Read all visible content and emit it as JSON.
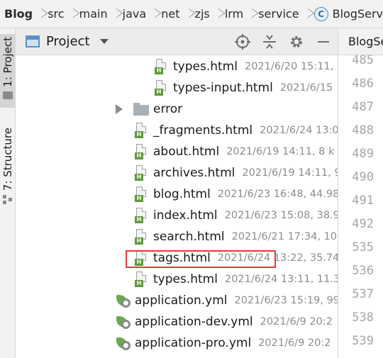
{
  "breadcrumb": {
    "items": [
      "Blog",
      "src",
      "main",
      "java",
      "net",
      "zjs",
      "lrm",
      "service"
    ],
    "current": "BlogServ",
    "class_icon_letter": "C"
  },
  "tool_strip": {
    "project_label": "1: Project",
    "structure_label": "7: Structure"
  },
  "panel": {
    "title": "Project",
    "icons": [
      "locate-icon",
      "collapse-icon",
      "gear-icon",
      "minimize-icon"
    ]
  },
  "tree": [
    {
      "type": "html",
      "name": "types.html",
      "meta": "2021/6/20 15:11,"
    },
    {
      "type": "html",
      "name": "types-input.html",
      "meta": "2021/6/15"
    },
    {
      "type": "folder",
      "name": "error",
      "meta": ""
    },
    {
      "type": "html",
      "name": "_fragments.html",
      "meta": "2021/6/24 13:0"
    },
    {
      "type": "html",
      "name": "about.html",
      "meta": "2021/6/19 14:11, 8 k"
    },
    {
      "type": "html",
      "name": "archives.html",
      "meta": "2021/6/19 14:11, 9"
    },
    {
      "type": "html",
      "name": "blog.html",
      "meta": "2021/6/23 16:48, 44.98"
    },
    {
      "type": "html",
      "name": "index.html",
      "meta": "2021/6/23 15:08, 38.9"
    },
    {
      "type": "html",
      "name": "search.html",
      "meta": "2021/6/21 17:34, 10"
    },
    {
      "type": "html",
      "name": "tags.html",
      "meta": "2021/6/24 13:22, 35.74"
    },
    {
      "type": "html",
      "name": "types.html",
      "meta": "2021/6/24 13:11, 11.3"
    },
    {
      "type": "yml",
      "name": "application.yml",
      "meta": "2021/6/23 15:19, 99"
    },
    {
      "type": "yml",
      "name": "application-dev.yml",
      "meta": "2021/6/9 20:2"
    },
    {
      "type": "yml",
      "name": "application-pro.yml",
      "meta": "2021/6/9 20:2"
    }
  ],
  "highlighted_item": "tags.html",
  "html_badge": "H",
  "editor": {
    "tab_label": "BlogSe",
    "line_numbers": [
      "485",
      "486",
      "487",
      "488",
      "489",
      "490",
      "491",
      "492",
      "535",
      "536",
      "537",
      "538",
      "539"
    ]
  },
  "colors": {
    "highlight_border": "#e53935",
    "html_badge": "#5e9a3a",
    "panel_header_bg": "#ececec"
  }
}
